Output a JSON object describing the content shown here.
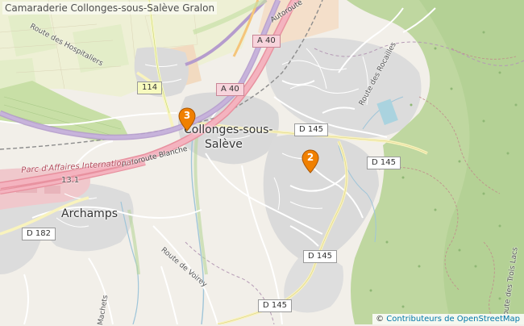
{
  "title": "Camaraderie Collonges-sous-Salève Gralon",
  "attribution": {
    "symbol": "©",
    "text": "Contributeurs de OpenStreetMap"
  },
  "road_shields": [
    "A 40",
    "A 40",
    "114",
    "D 145",
    "D 145",
    "D 145",
    "D 145",
    "D 182"
  ],
  "places": {
    "collonges_line1": "Collonges-sous-",
    "collonges_line2": "Salève",
    "archamps": "Archamps"
  },
  "streets": {
    "hospitaliers": "Route des Hospitaliers",
    "autoroute_top": "Autoroute",
    "autoroute_blanche": "Autoroute Blanche",
    "rocailles": "Route des Rocailles",
    "voirey": "Route de Voirey",
    "trois_lacs": "Route des Trois Lacs",
    "machets": "Machets"
  },
  "poi": {
    "parc_line1": "Parc d'Affaires International",
    "parc_line2": "13.1"
  },
  "markers": [
    {
      "number": "3",
      "color": "#f08000"
    },
    {
      "number": "2",
      "color": "#f08000"
    }
  ]
}
